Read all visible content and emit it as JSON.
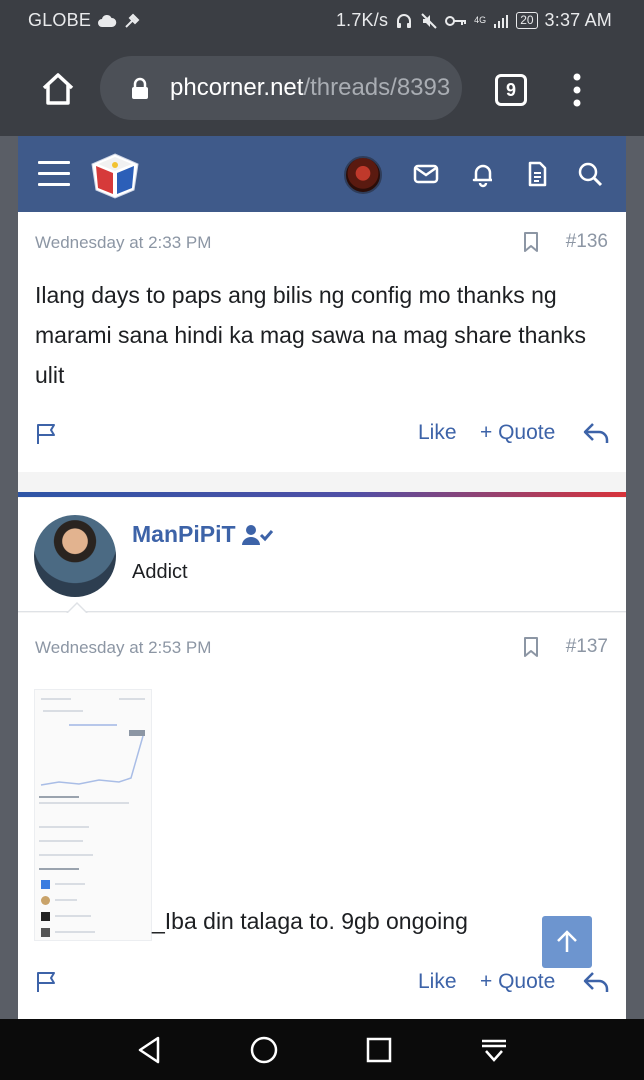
{
  "status_bar": {
    "carrier": "GLOBE",
    "speed": "1.7K/s",
    "network": "4G",
    "battery": "20",
    "time": "3:37 AM"
  },
  "browser": {
    "url_host": "phcorner.net",
    "url_path": "/threads/8393",
    "tab_count": "9"
  },
  "posts": [
    {
      "date": "Wednesday at 2:33 PM",
      "number": "#136",
      "text": "Ilang days to paps ang bilis ng config mo thanks ng marami sana hindi ka mag sawa na mag share thanks ulit",
      "like_label": "Like",
      "quote_label": "+ Quote"
    },
    {
      "user": {
        "name": "ManPiPiT",
        "title": "Addict"
      },
      "date": "Wednesday at 2:53 PM",
      "number": "#137",
      "attachment_text": "_Iba din talaga to. 9gb ongoing",
      "like_label": "Like",
      "quote_label": "+ Quote"
    }
  ],
  "colors": {
    "header": "#3f5a8a",
    "link": "#3d63a8",
    "meta": "#8c96a4"
  },
  "icons": [
    "home-icon",
    "lock-icon",
    "menu-dots-icon",
    "hamburger-icon",
    "mail-icon",
    "bell-icon",
    "document-icon",
    "search-icon",
    "bookmark-icon",
    "flag-icon",
    "reply-icon",
    "verified-user-icon",
    "arrow-up-icon",
    "back-icon",
    "home-circle-icon",
    "recents-icon",
    "notification-down-icon"
  ]
}
